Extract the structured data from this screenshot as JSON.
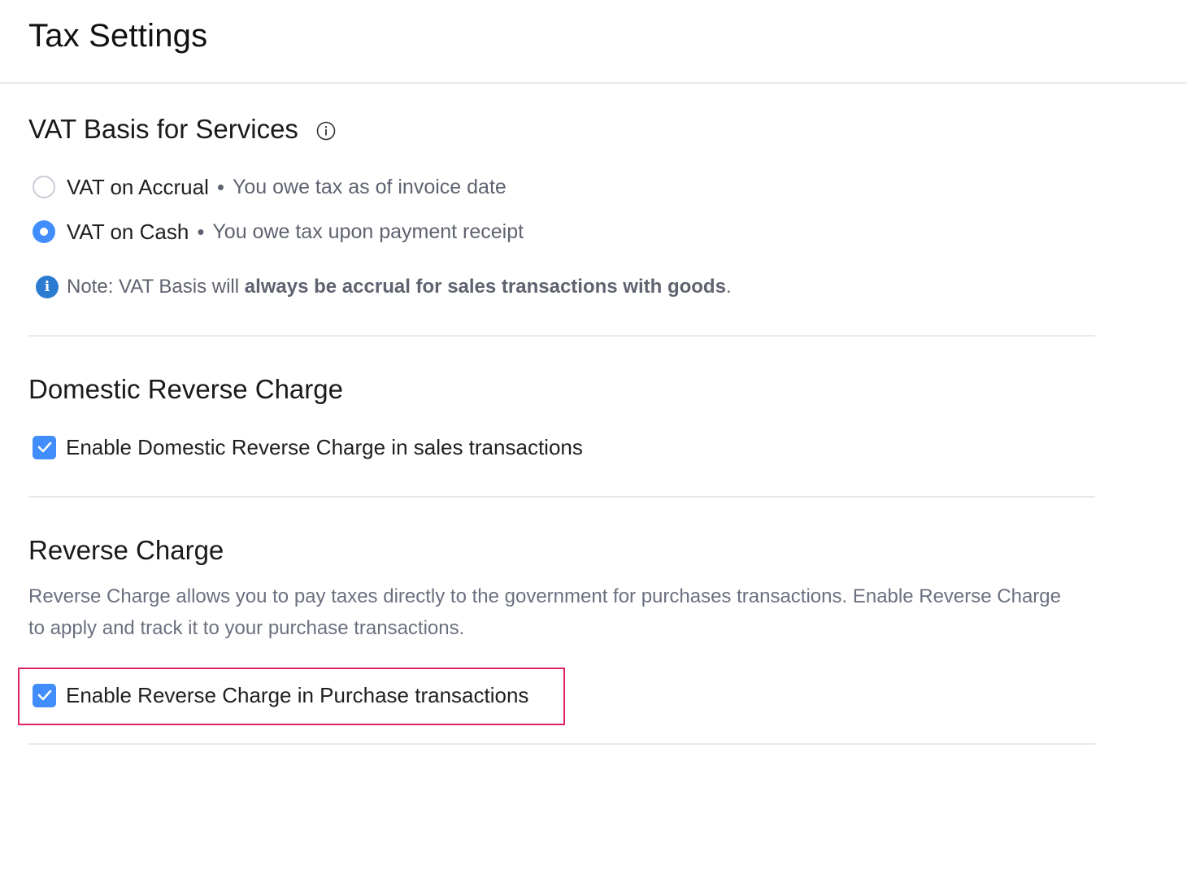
{
  "header": {
    "title": "Tax Settings"
  },
  "vat_basis": {
    "title": "VAT Basis for Services",
    "options": [
      {
        "label": "VAT on Accrual",
        "separator": "•",
        "description": "You owe tax as of invoice date",
        "selected": false
      },
      {
        "label": "VAT on Cash",
        "separator": "•",
        "description": "You owe tax upon payment receipt",
        "selected": true
      }
    ],
    "note": {
      "prefix": "Note: VAT Basis will ",
      "bold": "always be accrual for sales transactions with goods",
      "suffix": "."
    }
  },
  "domestic_reverse_charge": {
    "title": "Domestic Reverse Charge",
    "checkbox_label": "Enable Domestic Reverse Charge in sales transactions",
    "checked": true
  },
  "reverse_charge": {
    "title": "Reverse Charge",
    "description": "Reverse Charge allows you to pay taxes directly to the government for purchases transactions. Enable Reverse Charge to apply and track it to your purchase transactions.",
    "checkbox_label": "Enable Reverse Charge in Purchase transactions",
    "checked": true
  },
  "colors": {
    "accent": "#408dfb",
    "highlight": "#e0245e",
    "info": "#2b7bd1"
  }
}
